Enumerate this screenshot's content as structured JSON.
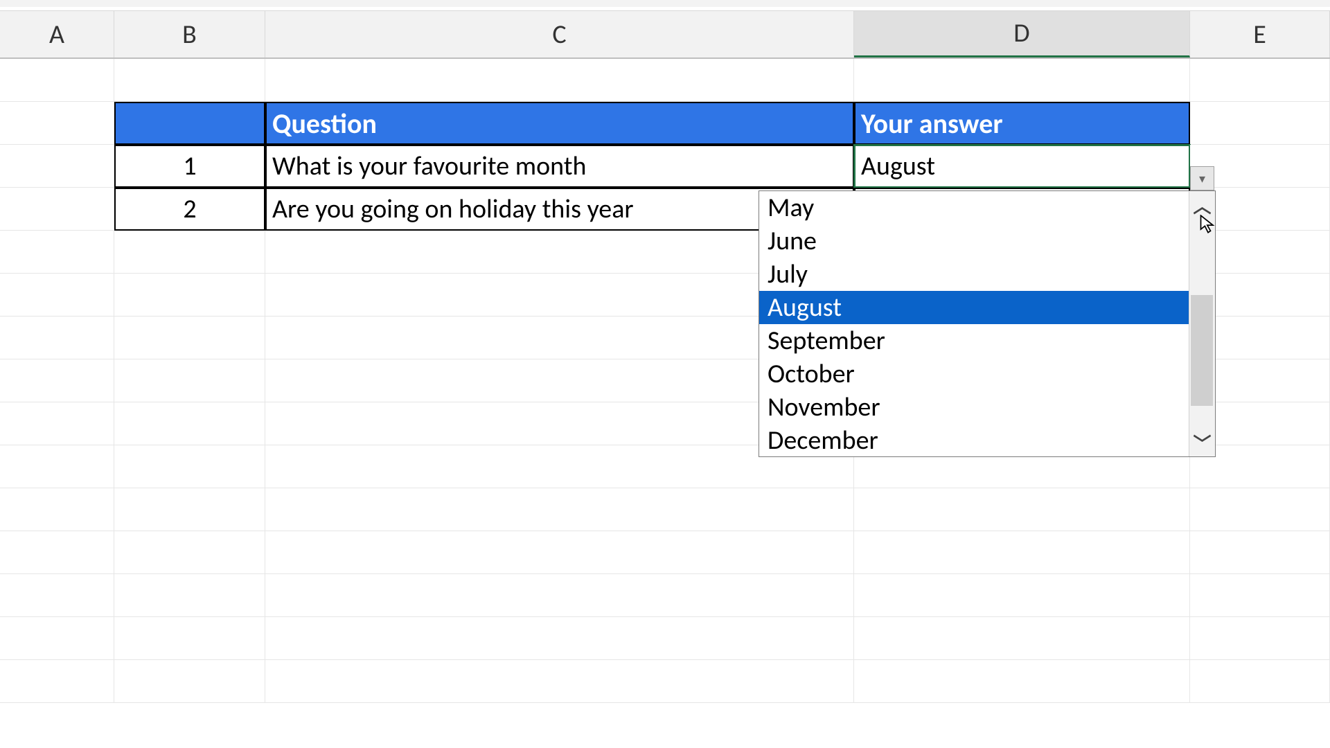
{
  "columns": {
    "A": "A",
    "B": "B",
    "C": "C",
    "D": "D",
    "E": "E"
  },
  "header": {
    "question": "Question",
    "answer": "Your answer"
  },
  "rows": [
    {
      "num": "1",
      "question": "What is your favourite month",
      "answer": "August"
    },
    {
      "num": "2",
      "question": "Are you going on holiday this year",
      "answer": ""
    }
  ],
  "dropdown": {
    "options": [
      "May",
      "June",
      "July",
      "August",
      "September",
      "October",
      "November",
      "December"
    ],
    "selected": "August"
  }
}
